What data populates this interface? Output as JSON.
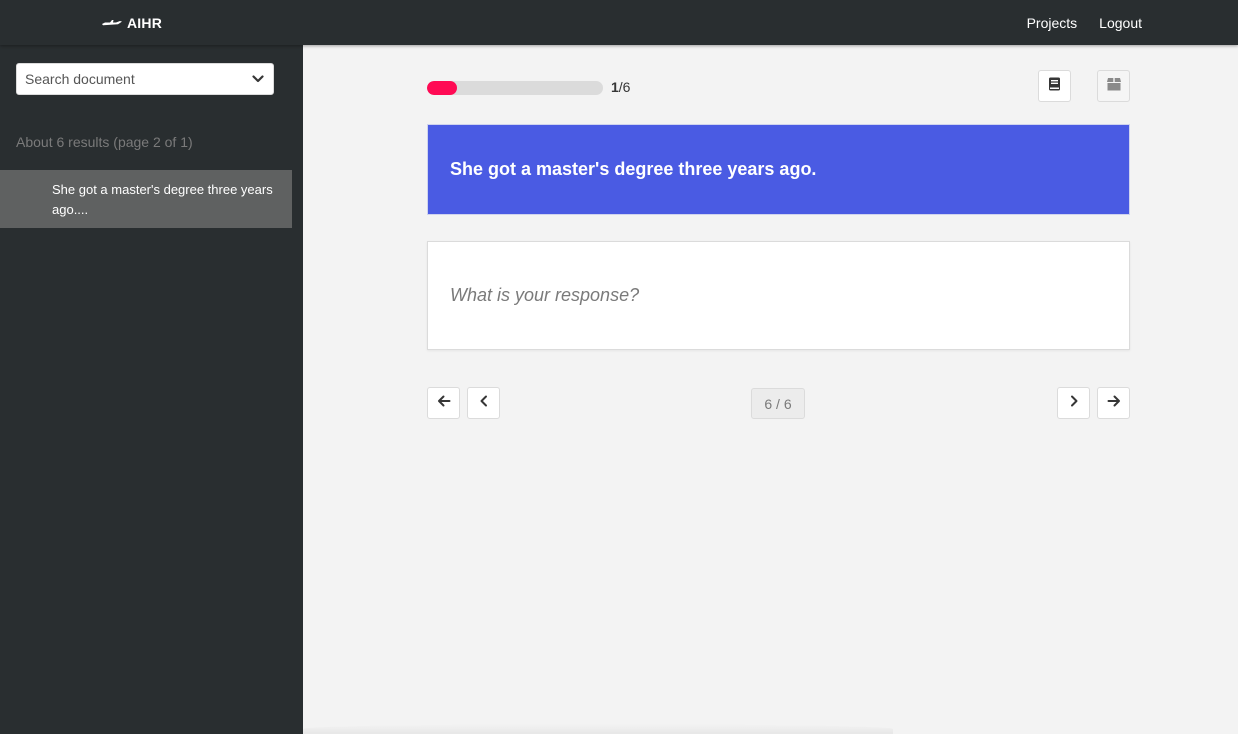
{
  "navbar": {
    "brand": "AIHR",
    "links": [
      "Projects",
      "Logout"
    ]
  },
  "sidebar": {
    "search_placeholder": "Search document",
    "results_summary": "About 6 results (page 2 of 1)",
    "results": [
      "She got a master's degree three years ago...."
    ]
  },
  "main": {
    "progress": {
      "current": "1",
      "total": "/6",
      "fraction": 0.17
    },
    "question": "She got a master's degree three years ago.",
    "response_placeholder": "What is your response?",
    "page_indicator": "6 / 6"
  },
  "colors": {
    "navbar": "#292e30",
    "accent_blue": "#4a5be3",
    "progress_fill": "#ff0a54",
    "active_result": "#5f6161"
  },
  "icons": {
    "brand": "airplane-icon",
    "search_dropdown": "chevron-down-icon",
    "toolbar_left": "book-icon",
    "toolbar_right": "box-icon",
    "first": "arrow-left-icon",
    "prev": "chevron-left-icon",
    "next": "chevron-right-icon",
    "last": "arrow-right-icon"
  }
}
